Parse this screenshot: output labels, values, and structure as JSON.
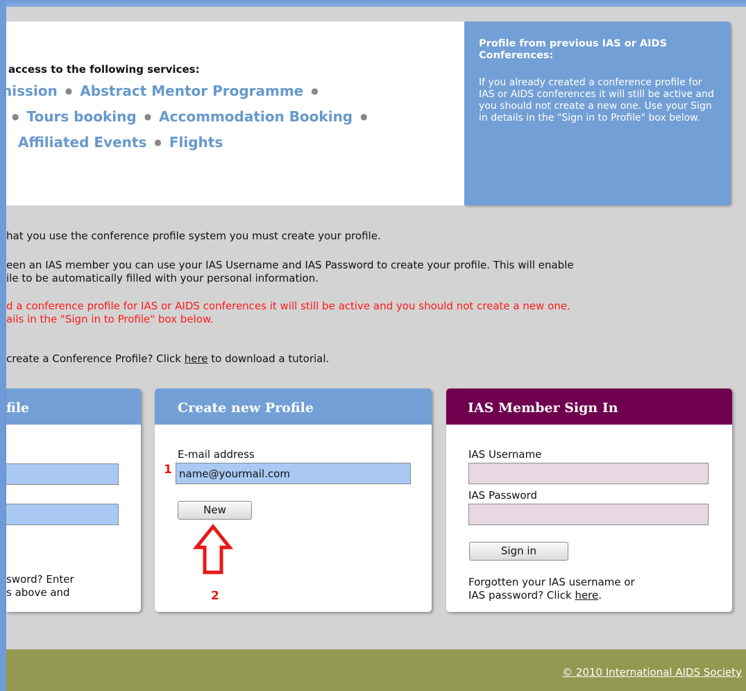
{
  "services": {
    "heading": "access to the following services:",
    "line1": [
      "nission",
      "Abstract Mentor Programme"
    ],
    "line2": [
      "Tours booking",
      "Accommodation Booking"
    ],
    "line3": [
      "Affiliated Events",
      "Flights"
    ]
  },
  "previous_profile": {
    "title": "Profile from previous IAS or AIDS Conferences:",
    "text": "If you already created a conference profile for IAS or AIDS conferences it will still be active and you should not create a new one. Use your Sign in details in the \"Sign in to Profile\" box below."
  },
  "paragraphs": {
    "p1": "hat you use the conference profile system you must create your profile.",
    "p2_line1": "een an IAS member you can use your IAS Username and IAS Password to create your profile. This will enable",
    "p2_line2": "ile to be automatically filled with your personal information.",
    "p3_line1": "d a conference profile for IAS or AIDS conferences it will still be active and you should not create a new one.",
    "p3_line2": "ails in the \"Sign in to Profile\" box below.",
    "p4_before": "create a Conference Profile? Click ",
    "p4_link": "here",
    "p4_after": " to download a tutorial."
  },
  "left_panel": {
    "title": "file",
    "text_line1": "sword? Enter",
    "text_line2": "s above and"
  },
  "create_panel": {
    "title": "Create new Profile",
    "email_label": "E-mail address",
    "email_value": "name@yourmail.com",
    "new_button": "New",
    "marker1": "1",
    "marker2": "2",
    "accent_color": "#e81818"
  },
  "sign_panel": {
    "title": "IAS Member Sign In",
    "username_label": "IAS Username",
    "password_label": "IAS Password",
    "sign_in_button": "Sign in",
    "forgot_before": "Forgotten your IAS username or IAS password? Click ",
    "forgot_link": "here",
    "forgot_after": ".",
    "header_color": "#6e004e"
  },
  "footer": {
    "copyright": "© 2010 International AIDS Society"
  }
}
